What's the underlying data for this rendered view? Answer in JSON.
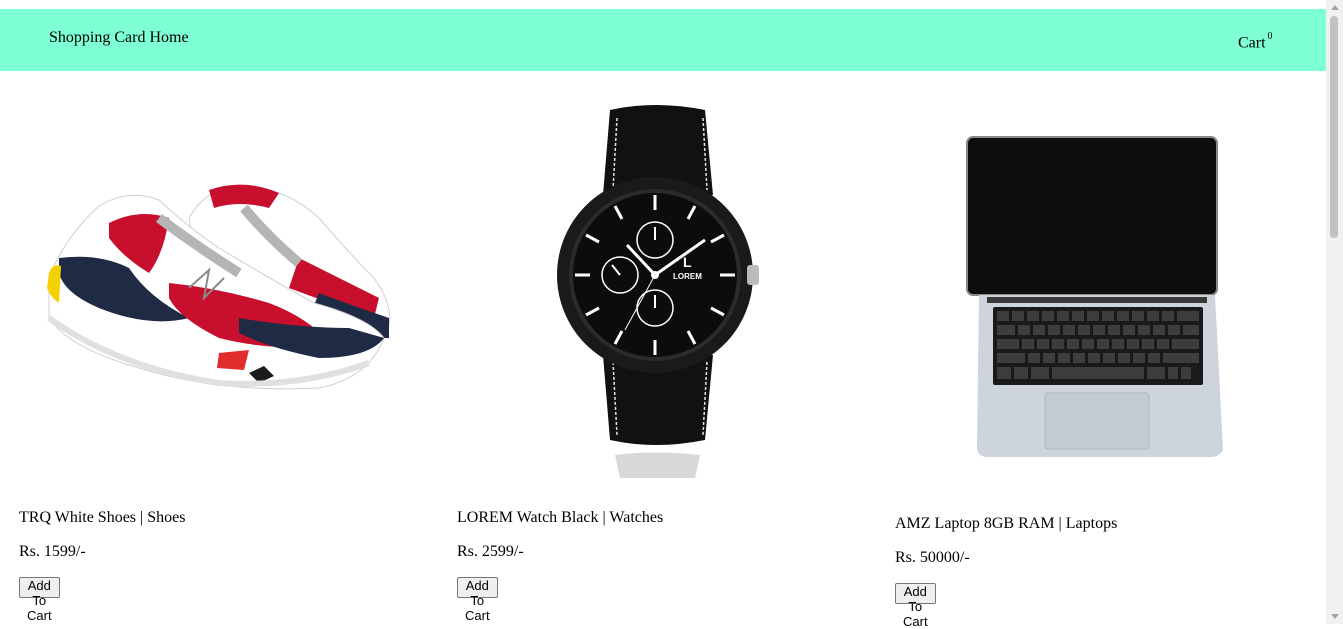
{
  "navbar": {
    "brand": "Shopping Card Home",
    "cart_label": "Cart",
    "cart_count": "0",
    "background": "#7fffd4"
  },
  "products": [
    {
      "title": "TRQ White Shoes | Shoes",
      "price": "Rs. 1599/-",
      "button": "Add To Cart",
      "image": "sneaker-image"
    },
    {
      "title": "LOREM Watch Black | Watches",
      "price": "Rs. 2599/-",
      "button": "Add To Cart",
      "image": "watch-image",
      "watch_brand_letter": "L",
      "watch_brand": "LOREM"
    },
    {
      "title": "AMZ Laptop 8GB RAM | Laptops",
      "price": "Rs. 50000/-",
      "button": "Add To Cart",
      "image": "laptop-image"
    }
  ]
}
